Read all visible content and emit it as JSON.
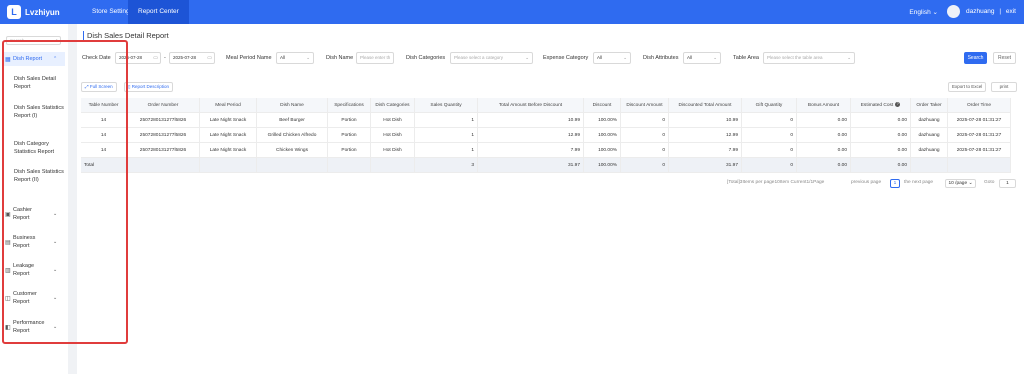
{
  "topbar": {
    "logo_text": "Lvzhiyun",
    "logo_mark": "L",
    "nav": [
      "Store Settings",
      "Report Center"
    ],
    "language": "English",
    "username": "dazhuang",
    "separator": "|",
    "exit_label": "exit"
  },
  "sidebar": {
    "search_placeholder": "Search",
    "dish_report": "Dish Report",
    "dish_items": [
      "Dish Sales Detail Report",
      "Dish Sales Statistics Report (I)",
      "Dish Category Statistics Report",
      "Dish Sales Statistics Report (II)"
    ],
    "groups": [
      {
        "label": "Cashier Report",
        "icon": "cashier-icon"
      },
      {
        "label": "Business Report",
        "icon": "business-icon"
      },
      {
        "label": "Leakage Report",
        "icon": "leakage-icon"
      },
      {
        "label": "Customer Report",
        "icon": "customer-icon"
      },
      {
        "label": "Performance Report",
        "icon": "performance-icon"
      }
    ]
  },
  "page": {
    "title": "Dish Sales Detail Report"
  },
  "filters": {
    "check_date_label": "Check Date",
    "date_start": "2025-07-28",
    "date_sep": "-",
    "date_end": "2025-07-28",
    "meal_period_label": "Meal Period Name",
    "meal_period_value": "All",
    "dish_name_label": "Dish Name",
    "dish_name_placeholder": "Please enter th",
    "dish_categories_label": "Dish Categories",
    "dish_categories_placeholder": "Please select a category",
    "expense_category_label": "Expense Category",
    "expense_category_value": "All",
    "dish_attributes_label": "Dish Attributes",
    "dish_attributes_value": "All",
    "table_area_label": "Table Area",
    "table_area_placeholder": "Please select the table area",
    "search_button": "Search",
    "reset_button": "Reset"
  },
  "toolbar": {
    "full_screen": "Full Screen",
    "report_description": "Report Description",
    "export_excel": "Export to Excel",
    "print": "print"
  },
  "table": {
    "headers": [
      "Table Number",
      "Order Number",
      "Meal Period",
      "Dish Name",
      "Specifications",
      "Dish Categories",
      "Sales Quantity",
      "Total Amount Before Discount",
      "Discount",
      "Discount Amount",
      "Discounted Total Amount",
      "Gift Quantity",
      "Bonus Amount",
      "Estimated Cost",
      "Order Taker",
      "Order Time"
    ],
    "rows": [
      [
        "14",
        "2507280131277l5826",
        "Late Night Snack",
        "Beef Burger",
        "Portion",
        "Hot Dish",
        "1",
        "10.99",
        "100.00%",
        "0",
        "10.99",
        "0",
        "0.00",
        "0.00",
        "dazhuang",
        "2025-07-28 01:31:27"
      ],
      [
        "14",
        "2507280131277l5826",
        "Late Night Snack",
        "Grilled Chicken Alfredo",
        "Portion",
        "Hot Dish",
        "1",
        "12.99",
        "100.00%",
        "0",
        "12.99",
        "0",
        "0.00",
        "0.00",
        "dazhuang",
        "2025-07-28 01:31:27"
      ],
      [
        "14",
        "2507280131277l5826",
        "Late Night Snack",
        "Chicken Wings",
        "Portion",
        "Hot Dish",
        "1",
        "7.99",
        "100.00%",
        "0",
        "7.99",
        "0",
        "0.00",
        "0.00",
        "dazhuang",
        "2025-07-28 01:31:27"
      ]
    ],
    "total_row": [
      "Total",
      "",
      "",
      "",
      "",
      "",
      "3",
      "31.97",
      "100.00%",
      "0",
      "31.97",
      "0",
      "0.00",
      "0.00",
      "",
      ""
    ]
  },
  "pagination": {
    "summary": "[Total]3Items per page10Item Current1/1Page",
    "previous": "previous page",
    "current_page": "1",
    "next": "the next page",
    "page_size": "10 /page",
    "goto_label": "Goto",
    "goto_value": "1"
  },
  "colors": {
    "brand": "#2f6bf0",
    "highlight": "#e03c3c"
  }
}
